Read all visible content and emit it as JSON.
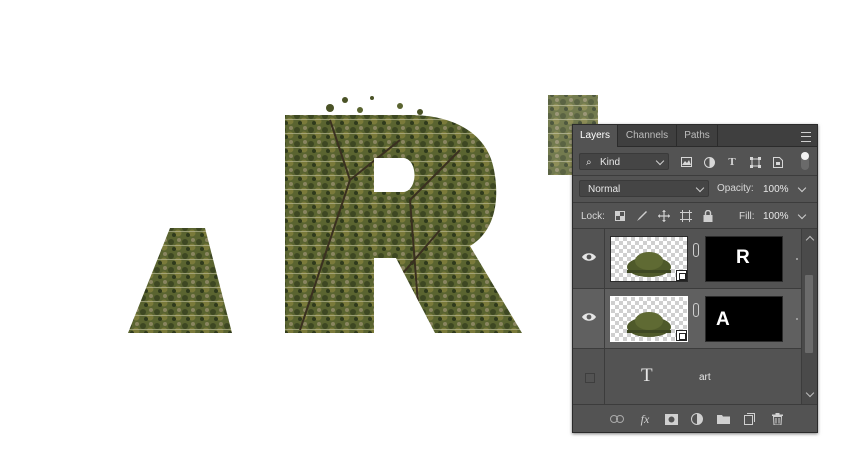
{
  "tabs": [
    {
      "label": "Layers",
      "active": true
    },
    {
      "label": "Channels",
      "active": false
    },
    {
      "label": "Paths",
      "active": false
    }
  ],
  "filter": {
    "kind_label": "Kind"
  },
  "blend": {
    "mode": "Normal",
    "opacity_label": "Opacity:",
    "opacity_value": "100%"
  },
  "lock": {
    "label": "Lock:",
    "fill_label": "Fill:",
    "fill_value": "100%"
  },
  "layers": [
    {
      "mask_letter": "R",
      "visible": true,
      "selected": false
    },
    {
      "mask_letter": "A",
      "visible": true,
      "selected": true
    },
    {
      "name": "art",
      "visible": false,
      "type": "text"
    }
  ],
  "colors": {
    "panel": "#535353",
    "tabbar": "#3f3f3f",
    "foliage": "#4f5a2a"
  }
}
